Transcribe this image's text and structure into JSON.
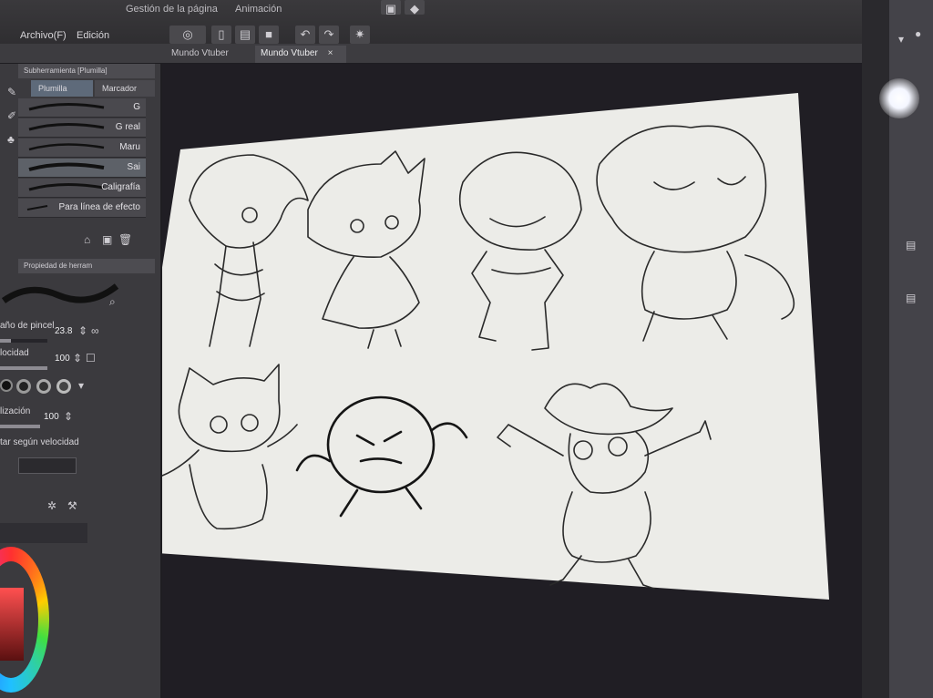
{
  "menu": {
    "archivo": "Archivo(F)",
    "edicion": "Edición",
    "gestion": "Gestión de la página",
    "animacion": "Animación"
  },
  "tabs": [
    {
      "label": "Mundo Vtuber"
    },
    {
      "label": "Mundo Vtuber",
      "close": "×"
    }
  ],
  "subtool": {
    "header": "Subherramienta [Plumilla]",
    "tab_plumilla": "Plumilla",
    "tab_marcador": "Marcador",
    "brushes": [
      {
        "name": "G"
      },
      {
        "name": "G real"
      },
      {
        "name": "Maru"
      },
      {
        "name": "Sai"
      },
      {
        "name": "Caligrafía"
      },
      {
        "name": "Para línea de efecto"
      }
    ]
  },
  "tool_property": {
    "header": "Propiedad de herram",
    "brush_size_label": "año de pincel",
    "brush_size_value": "23.8",
    "velocity_label": "locidad",
    "velocity_value": "100",
    "stabilization_label": "lización",
    "stabilization_value": "100",
    "velocity_adjust_label": "tar según velocidad",
    "brush_size_level": 0.24,
    "velocity_level": 1.0,
    "stabilization_level": 1.0
  },
  "colors": {
    "panel": "#3b3a3e",
    "canvas_paper": "#ebebe6",
    "ink": "#1a1a1a"
  }
}
